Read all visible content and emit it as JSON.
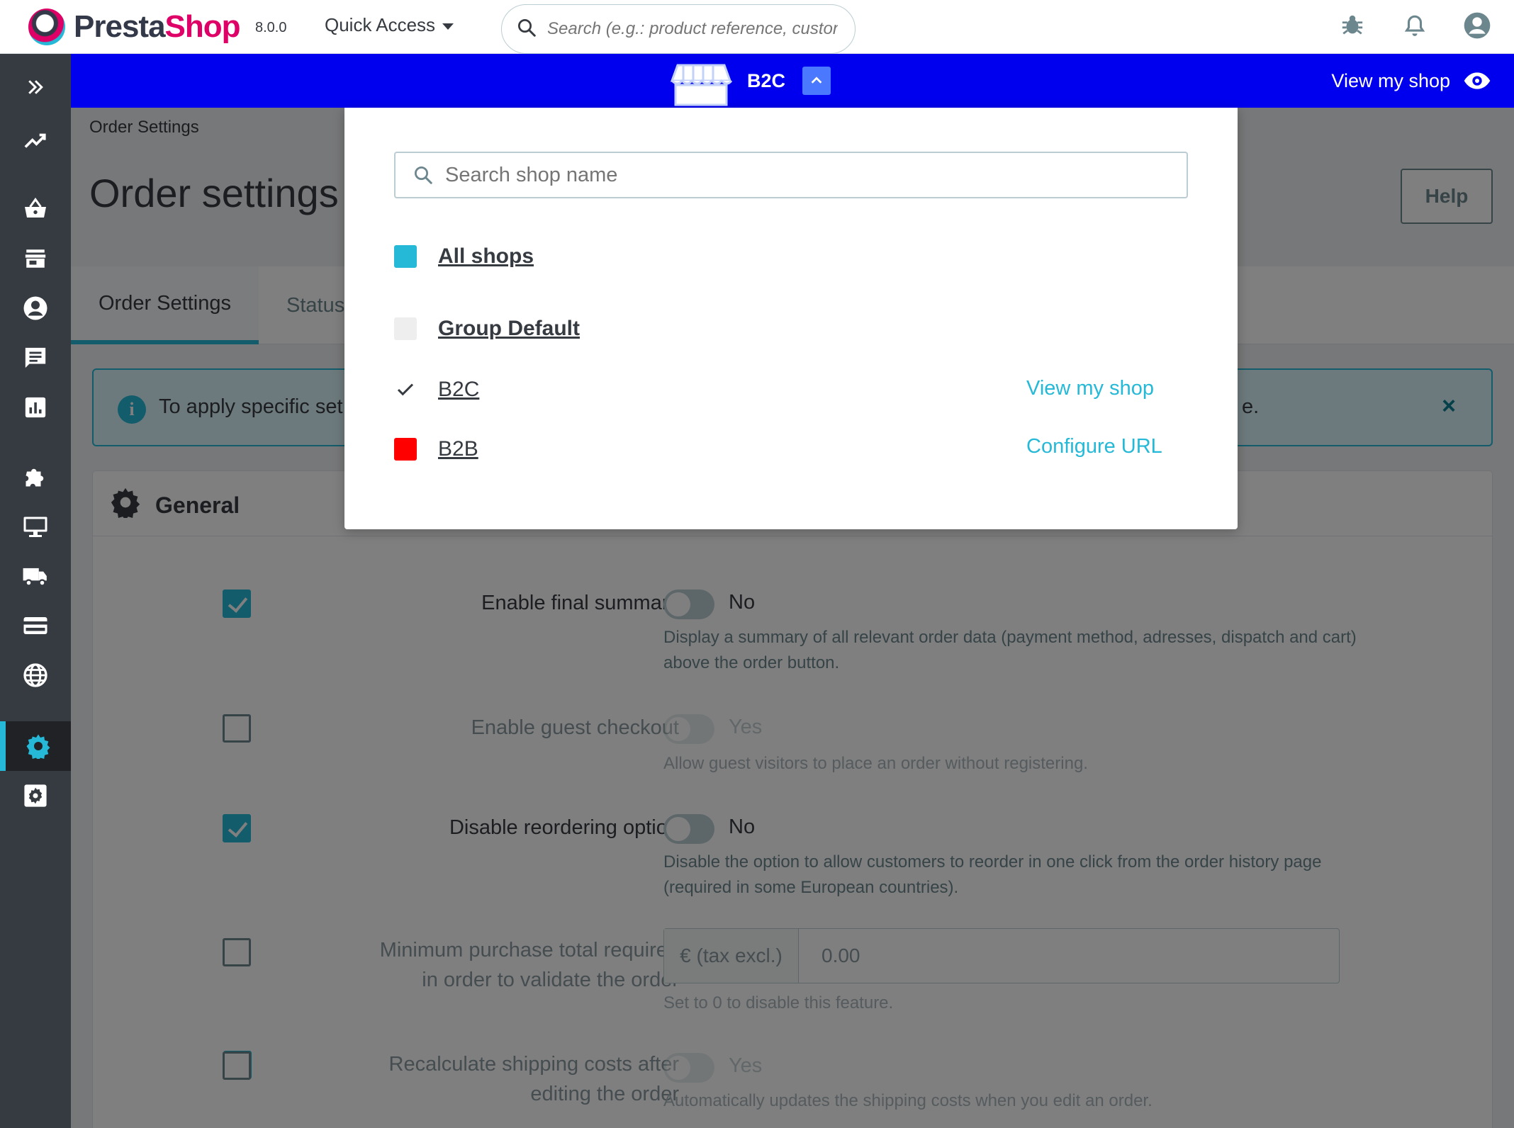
{
  "header": {
    "logo_text_a": "Presta",
    "logo_text_b": "Shop",
    "version": "8.0.0",
    "quick_access": "Quick Access",
    "search_placeholder": "Search (e.g.: product reference, custon",
    "icons": [
      "bug-icon",
      "bell-icon",
      "account-icon"
    ]
  },
  "shopbar": {
    "current_shop": "B2C",
    "view_shop": "View my shop",
    "bar_color": "#0000ee"
  },
  "sidebar": {
    "items": [
      "expand-icon",
      "stats-trend-icon",
      "orders-basket-icon",
      "catalog-store-icon",
      "customers-icon",
      "messages-icon",
      "reports-icon",
      "modules-puzzle-icon",
      "design-monitor-icon",
      "shipping-truck-icon",
      "payment-card-icon",
      "international-globe-icon",
      "settings-gear-icon",
      "advanced-settings-icon"
    ],
    "active": "settings-gear-icon",
    "accent": "#25b9d7"
  },
  "page": {
    "breadcrumb": "Order Settings",
    "title": "Order settings",
    "help_label": "Help",
    "tabs": [
      {
        "label": "Order Settings",
        "active": true
      },
      {
        "label": "Status",
        "active": false
      }
    ],
    "alert_text": "To apply specific set",
    "alert_text_end": "e.",
    "alert_close": "×"
  },
  "panel": {
    "title": "General",
    "rows": [
      {
        "label": "Enable final summary",
        "checked": true,
        "switch": "No",
        "help": "Display a summary of all relevant order data (payment method, adresses, dispatch and cart) above the order button.",
        "enabled": true
      },
      {
        "label": "Enable guest checkout",
        "checked": false,
        "switch": "Yes",
        "help": "Allow guest visitors to place an order without registering.",
        "enabled": false
      },
      {
        "label": "Disable reordering option",
        "checked": true,
        "switch": "No",
        "help": "Disable the option to allow customers to reorder in one click from the order history page (required in some European countries).",
        "enabled": true
      },
      {
        "label_line1": "Minimum purchase total required",
        "label_line2": "in order to validate the order",
        "checked": false,
        "prefix": "€ (tax excl.)",
        "value": "0.00",
        "help": "Set to 0 to disable this feature.",
        "enabled": false
      },
      {
        "label_line1": "Recalculate shipping costs after",
        "label_line2": "editing the order",
        "checked": false,
        "switch": "Yes",
        "help": "Automatically updates the shipping costs when you edit an order.",
        "enabled": false
      }
    ]
  },
  "dropdown": {
    "search_placeholder": "Search shop name",
    "items": [
      {
        "name": "All shops",
        "color": "#25b9d7",
        "bold": true,
        "action": ""
      },
      {
        "name": "Group Default",
        "color": "#eeeeee",
        "bold": true,
        "action": ""
      },
      {
        "name": "B2C",
        "color": "",
        "selected": true,
        "bold": false,
        "action": "View my shop"
      },
      {
        "name": "B2B",
        "color": "#ff0000",
        "bold": false,
        "action": "Configure URL"
      }
    ]
  }
}
